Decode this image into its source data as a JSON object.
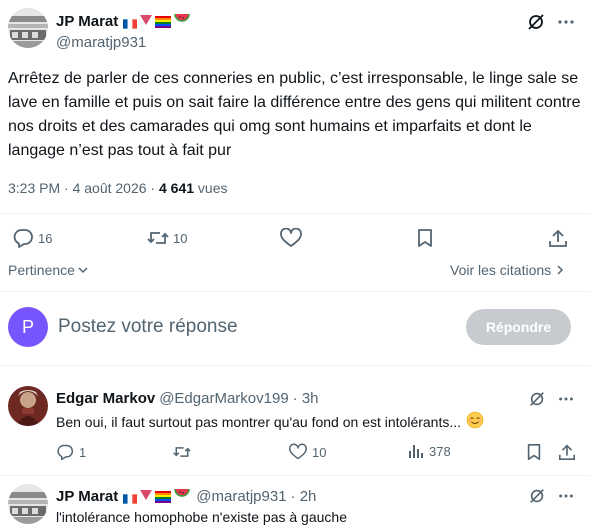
{
  "main_tweet": {
    "author_name": "JP Marat",
    "author_handle": "@maratjp931",
    "text": "Arrêtez de parler de ces conneries en public, c’est irresponsable, le linge sale se lave en famille et puis on sait faire la différence entre des gens qui militent contre nos droits et des camarades qui omg sont humains et imparfaits et dont le langage n’est pas tout à fait pur",
    "time": "3:23 PM · 4 août 2026 · ",
    "views_count": "4 641",
    "views_label": " vues",
    "replies": "16",
    "retweets": "10",
    "likes": "",
    "icons": [
      "reply-icon",
      "retweet-icon",
      "like-icon",
      "bookmark-icon",
      "share-icon",
      "grok-icon",
      "more-icon"
    ]
  },
  "sort": {
    "label": "Pertinence",
    "quotes_link": "Voir les citations"
  },
  "composer": {
    "avatar_letter": "P",
    "placeholder": "Postez votre réponse",
    "button": "Répondre",
    "avatar_color": "#7856ff"
  },
  "replies": [
    {
      "author_name": "Edgar Markov",
      "author_handle": "@EdgarMarkov199",
      "time": "· 3h",
      "text": "Ben oui, il faut surtout pas montrer qu'au fond on est intolérants...",
      "replies": "1",
      "retweets": "",
      "likes": "10",
      "views": "378"
    },
    {
      "author_name": "JP Marat",
      "author_handle": "@maratjp931",
      "time": "· 2h",
      "text": "l'intolérance homophobe n'existe pas à gauche"
    }
  ]
}
